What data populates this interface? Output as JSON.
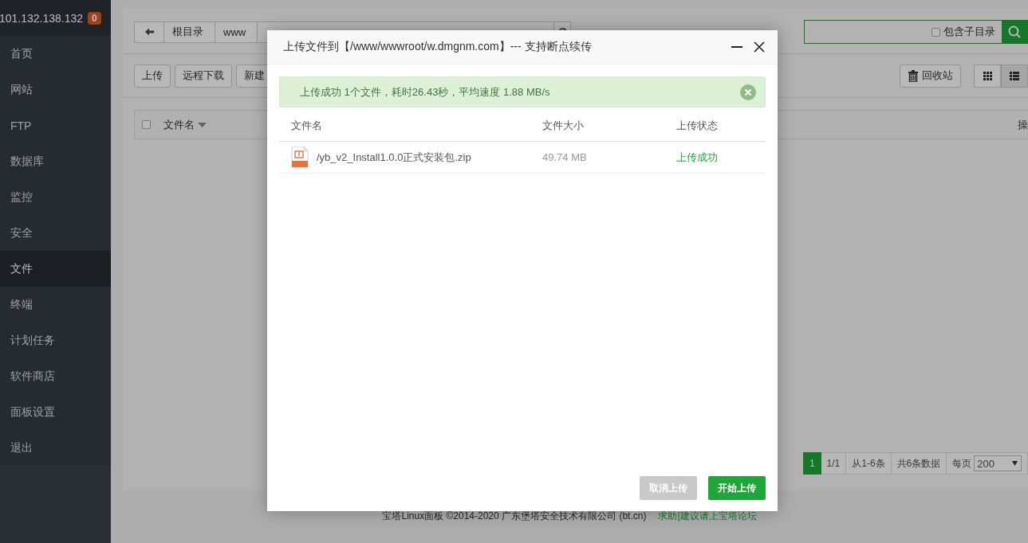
{
  "sidebar": {
    "host": "101.132.138.132",
    "badge": "0",
    "items": [
      {
        "label": "首页",
        "selected": false
      },
      {
        "label": "网站",
        "selected": false
      },
      {
        "label": "FTP",
        "selected": false
      },
      {
        "label": "数据库",
        "selected": false
      },
      {
        "label": "监控",
        "selected": false
      },
      {
        "label": "安全",
        "selected": false
      },
      {
        "label": "文件",
        "selected": true
      },
      {
        "label": "终端",
        "selected": false
      },
      {
        "label": "计划任务",
        "selected": false
      },
      {
        "label": "软件商店",
        "selected": false
      },
      {
        "label": "面板设置",
        "selected": false
      },
      {
        "label": "退出",
        "selected": false
      }
    ]
  },
  "breadcrumb": {
    "segments": [
      "根目录",
      "www"
    ]
  },
  "search": {
    "option": {
      "label": "包含子目录",
      "checked": false
    }
  },
  "toolbar": {
    "buttons": [
      "上传",
      "远程下载",
      "新建"
    ],
    "recycle": "回收站",
    "views": [
      {
        "kind": "grid",
        "selected": false
      },
      {
        "kind": "list",
        "selected": true
      }
    ]
  },
  "file_table": {
    "select_all": false,
    "columns": [
      "文件名",
      "操"
    ]
  },
  "pagination": {
    "pages": [
      {
        "label": "1",
        "selected": true
      }
    ],
    "items": [
      "1/1",
      "从1-6条",
      "共6条数据"
    ],
    "page_size_label": "每页",
    "page_size": "200"
  },
  "footer": {
    "copyright": "宝塔Linux面板 ©2014-2020 广东堡塔安全技术有限公司 (bt.cn)",
    "link": "求助|建议请上宝塔论坛"
  },
  "dialog": {
    "title": "上传文件到【/www/wwwroot/w.dmgnm.com】--- 支持断点续传",
    "alert": "上传成功 1个文件，耗时26.43秒，平均速度 1.88 MB/s",
    "columns": [
      "文件名",
      "文件大小",
      "上传状态"
    ],
    "files": [
      {
        "name": "/yb_v2_Install1.0.0正式安装包.zip",
        "size": "49.74 MB",
        "status": "上传成功",
        "kind": "zip"
      }
    ],
    "buttons": [
      {
        "label": "取消上传",
        "disabled": true
      },
      {
        "label": "开始上传",
        "disabled": false
      }
    ]
  }
}
